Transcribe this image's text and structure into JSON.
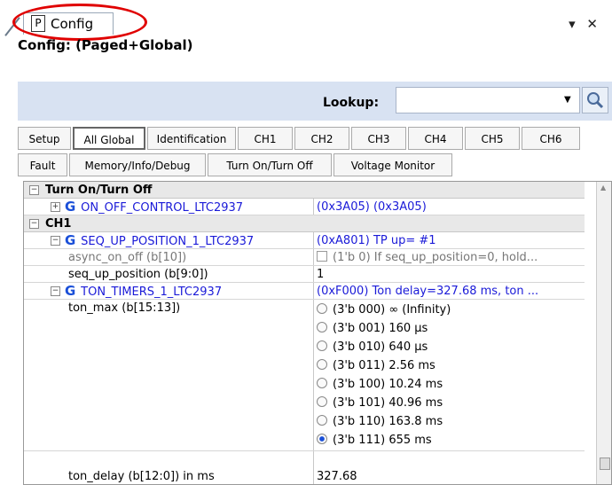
{
  "tab": {
    "prefix": "P",
    "label": "Config"
  },
  "window_controls": "▾ ✕",
  "config_title": "Config:  (Paged+Global)",
  "lookup": {
    "label": "Lookup:",
    "value": ""
  },
  "tabs_row1": [
    "Setup",
    "All Global",
    "Identification",
    "CH1",
    "CH2",
    "CH3",
    "CH4",
    "CH5",
    "CH6"
  ],
  "tabs_row2": [
    "Fault",
    "Memory/Info/Debug",
    "Turn On/Turn Off",
    "Voltage Monitor"
  ],
  "active_tab": "All Global",
  "grid": {
    "section_turn_on_off": "Turn On/Turn Off",
    "on_off_name": "ON_OFF_CONTROL_LTC2937",
    "on_off_val": "(0x3A05) (0x3A05)",
    "section_ch1": "CH1",
    "seq_up_name": "SEQ_UP_POSITION_1_LTC2937",
    "seq_up_val": "(0xA801) TP up= #1",
    "async_name": "async_on_off (b[10])",
    "async_val": "(1'b 0) If seq_up_position=0, hold...",
    "seqpos_name": "seq_up_position (b[9:0])",
    "seqpos_val": "1",
    "ton_timers_name": "TON_TIMERS_1_LTC2937",
    "ton_timers_val": "(0xF000) Ton delay=327.68 ms, ton ...",
    "ton_max_name": "ton_max (b[15:13])",
    "ton_max_options": [
      "(3'b 000) ∞ (Infinity)",
      "(3'b 001) 160 µs",
      "(3'b 010) 640 µs",
      "(3'b 011) 2.56 ms",
      "(3'b 100) 10.24 ms",
      "(3'b 101) 40.96 ms",
      "(3'b 110) 163.8 ms",
      "(3'b 111) 655 ms"
    ],
    "ton_max_selected_index": 7,
    "ton_delay_name": "ton_delay (b[12:0]) in ms",
    "ton_delay_val": "327.68"
  },
  "colors": {
    "accent_red": "#e00000",
    "link_blue": "#1a1ad8",
    "lookup_band": "#d8e2f2"
  }
}
